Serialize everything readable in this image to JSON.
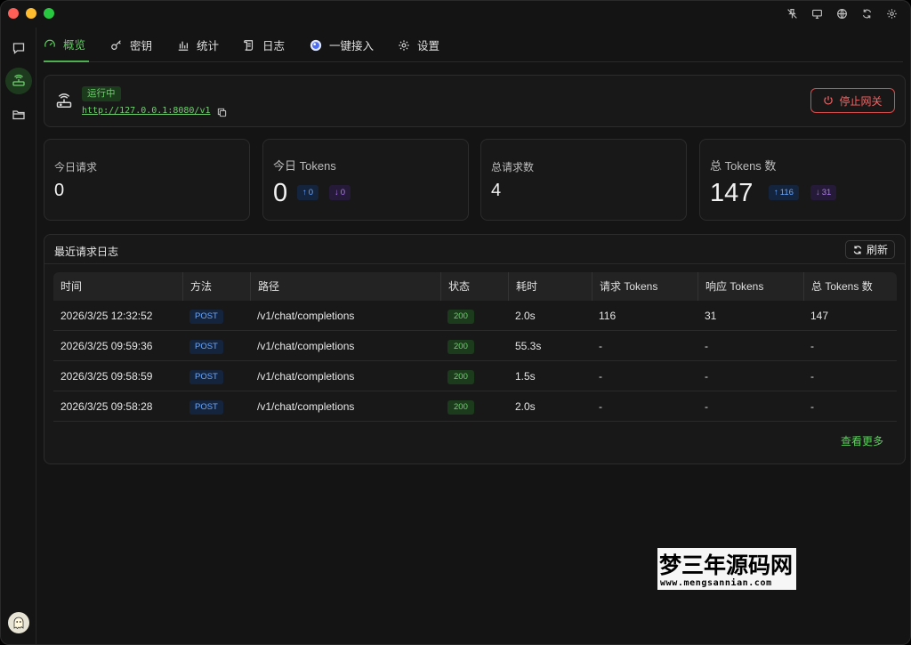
{
  "tabs": [
    {
      "label": "概览",
      "icon": "gauge-icon"
    },
    {
      "label": "密钥",
      "icon": "key-icon"
    },
    {
      "label": "统计",
      "icon": "bar-chart-icon"
    },
    {
      "label": "日志",
      "icon": "scroll-icon"
    },
    {
      "label": "一键接入",
      "icon": "app-logo-icon"
    },
    {
      "label": "设置",
      "icon": "gear-icon"
    }
  ],
  "gateway": {
    "status": "运行中",
    "url": "http://127.0.0.1:8080/v1",
    "stop_label": "停止网关"
  },
  "stats": {
    "today_requests": {
      "label": "今日请求",
      "value": "0"
    },
    "today_tokens": {
      "label": "今日 Tokens",
      "value": "0",
      "up": "0",
      "down": "0"
    },
    "total_requests": {
      "label": "总请求数",
      "value": "4"
    },
    "total_tokens": {
      "label": "总 Tokens 数",
      "value": "147",
      "up": "116",
      "down": "31"
    }
  },
  "log": {
    "title": "最近请求日志",
    "refresh_label": "刷新",
    "columns": [
      "时间",
      "方法",
      "路径",
      "状态",
      "耗时",
      "请求 Tokens",
      "响应 Tokens",
      "总 Tokens 数"
    ],
    "rows": [
      {
        "time": "2026/3/25 12:32:52",
        "method": "POST",
        "path": "/v1/chat/completions",
        "status": "200",
        "duration": "2.0s",
        "req": "116",
        "resp": "31",
        "total": "147"
      },
      {
        "time": "2026/3/25 09:59:36",
        "method": "POST",
        "path": "/v1/chat/completions",
        "status": "200",
        "duration": "55.3s",
        "req": "-",
        "resp": "-",
        "total": "-"
      },
      {
        "time": "2026/3/25 09:58:59",
        "method": "POST",
        "path": "/v1/chat/completions",
        "status": "200",
        "duration": "1.5s",
        "req": "-",
        "resp": "-",
        "total": "-"
      },
      {
        "time": "2026/3/25 09:58:28",
        "method": "POST",
        "path": "/v1/chat/completions",
        "status": "200",
        "duration": "2.0s",
        "req": "-",
        "resp": "-",
        "total": "-"
      }
    ],
    "more_label": "查看更多"
  },
  "watermark": {
    "cn": "梦三年源码网",
    "en": "www.mengsannian.com"
  },
  "colors": {
    "accent": "#4caf50",
    "danger": "#d94a4a",
    "up": "#6aa8ff",
    "down": "#b07cf2"
  }
}
